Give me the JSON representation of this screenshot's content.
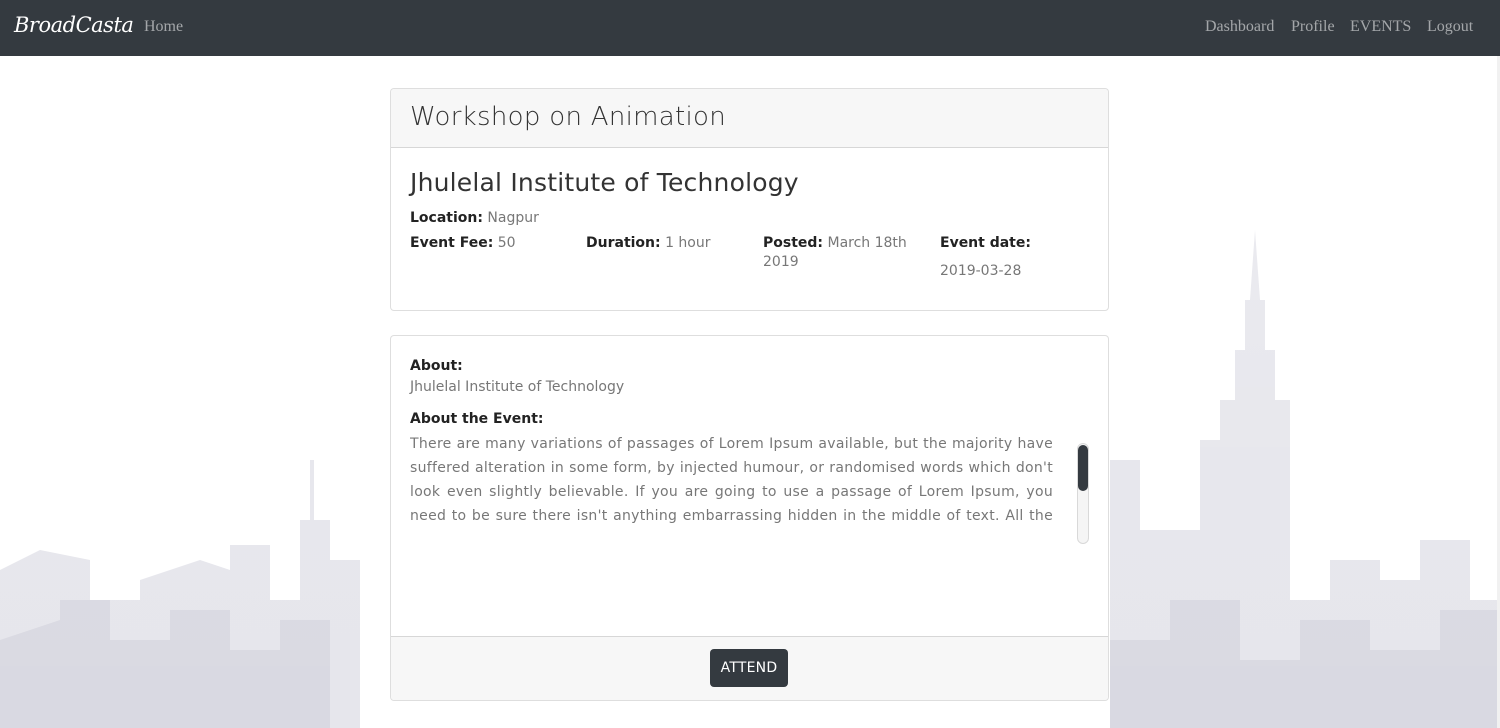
{
  "navbar": {
    "brand": "BroadCasta",
    "home": "Home",
    "links": {
      "dashboard": "Dashboard",
      "profile": "Profile",
      "events": "EVENTS",
      "logout": "Logout"
    }
  },
  "event": {
    "title": "Workshop on Animation",
    "institute": "Jhulelal Institute of Technology",
    "location_label": "Location:",
    "location": "Nagpur",
    "fee_label": "Event Fee:",
    "fee": "50",
    "duration_label": "Duration:",
    "duration": "1 hour",
    "posted_label": "Posted:",
    "posted": "March 18th 2019",
    "date_label": "Event date:",
    "date": "2019-03-28"
  },
  "about": {
    "about_label": "About:",
    "about_value": "Jhulelal Institute of Technology",
    "event_label": "About the Event:",
    "event_description": "There are many variations of passages of Lorem Ipsum available, but the majority have suffered alteration in some form, by injected humour, or randomised words which don't look even slightly believable. If you are going to use a passage of Lorem Ipsum, you need to be sure there isn't anything embarrassing hidden in the middle of text. All the Lorem Ipsum generators on the Internet tend to repeat predefined chunks as necessary, making this the first true generator on the Internet."
  },
  "actions": {
    "attend": "ATTEND"
  },
  "colors": {
    "navbar_bg": "#343a40",
    "button_bg": "#343a40",
    "card_header_bg": "#f7f7f7"
  }
}
